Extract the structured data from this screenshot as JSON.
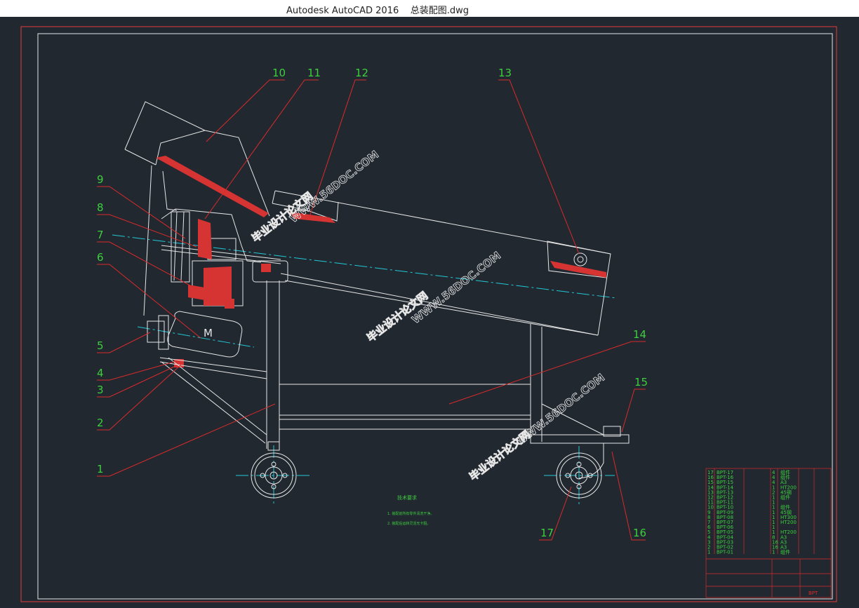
{
  "window": {
    "app_name": "Autodesk AutoCAD 2016",
    "file_name": "总装配图.dwg"
  },
  "colors": {
    "background": "#212830",
    "frame": "#e33b3b",
    "geometry": "#e6e6e6",
    "centerline": "#22c8d6",
    "leader": "#d92b2b",
    "balloon_text": "#3ecf3e",
    "hatch": "#d63333",
    "watermark": "#e6e6e6"
  },
  "balloons": {
    "b1": "1",
    "b2": "2",
    "b3": "3",
    "b4": "4",
    "b5": "5",
    "b6": "6",
    "b7": "7",
    "b8": "8",
    "b9": "9",
    "b10": "10",
    "b11": "11",
    "b12": "12",
    "b13": "13",
    "b14": "14",
    "b15": "15",
    "b16": "16",
    "b17": "17"
  },
  "motor_label": "M",
  "watermark": {
    "domain": "WWW.56DOC.COM",
    "site": "毕业设计论文网"
  },
  "tech_requirements": {
    "title": "技术要求",
    "line1": "1. 装配前所有零件清洗干净。",
    "line2": "2. 装配后运转灵活无卡阻。"
  },
  "bom": {
    "rows": [
      {
        "no": "17",
        "code": "BPT-17",
        "qty": "4",
        "mat": "组件"
      },
      {
        "no": "16",
        "code": "BPT-16",
        "qty": "4",
        "mat": "组件"
      },
      {
        "no": "15",
        "code": "BPT-15",
        "qty": "4",
        "mat": "A3"
      },
      {
        "no": "14",
        "code": "BPT-14",
        "qty": "1",
        "mat": "HT200"
      },
      {
        "no": "13",
        "code": "BPT-13",
        "qty": "2",
        "mat": "45钢"
      },
      {
        "no": "12",
        "code": "BPT-12",
        "qty": "1",
        "mat": "组件"
      },
      {
        "no": "11",
        "code": "BPT-11",
        "qty": "1",
        "mat": ""
      },
      {
        "no": "10",
        "code": "BPT-10",
        "qty": "1",
        "mat": "组件"
      },
      {
        "no": "9",
        "code": "BPT-09",
        "qty": "1",
        "mat": "45钢"
      },
      {
        "no": "8",
        "code": "BPT-08",
        "qty": "1",
        "mat": "HT300"
      },
      {
        "no": "7",
        "code": "BPT-07",
        "qty": "1",
        "mat": "HT200"
      },
      {
        "no": "6",
        "code": "BPT-06",
        "qty": "1",
        "mat": ""
      },
      {
        "no": "5",
        "code": "BPT-05",
        "qty": "1",
        "mat": "HT200"
      },
      {
        "no": "4",
        "code": "BPT-04",
        "qty": "8",
        "mat": "A3"
      },
      {
        "no": "3",
        "code": "BPT-03",
        "qty": "16",
        "mat": "A3"
      },
      {
        "no": "2",
        "code": "BPT-02",
        "qty": "16",
        "mat": "A3"
      },
      {
        "no": "1",
        "code": "BPT-01",
        "qty": "1",
        "mat": "组件"
      }
    ],
    "drawing_no": "BPT"
  }
}
